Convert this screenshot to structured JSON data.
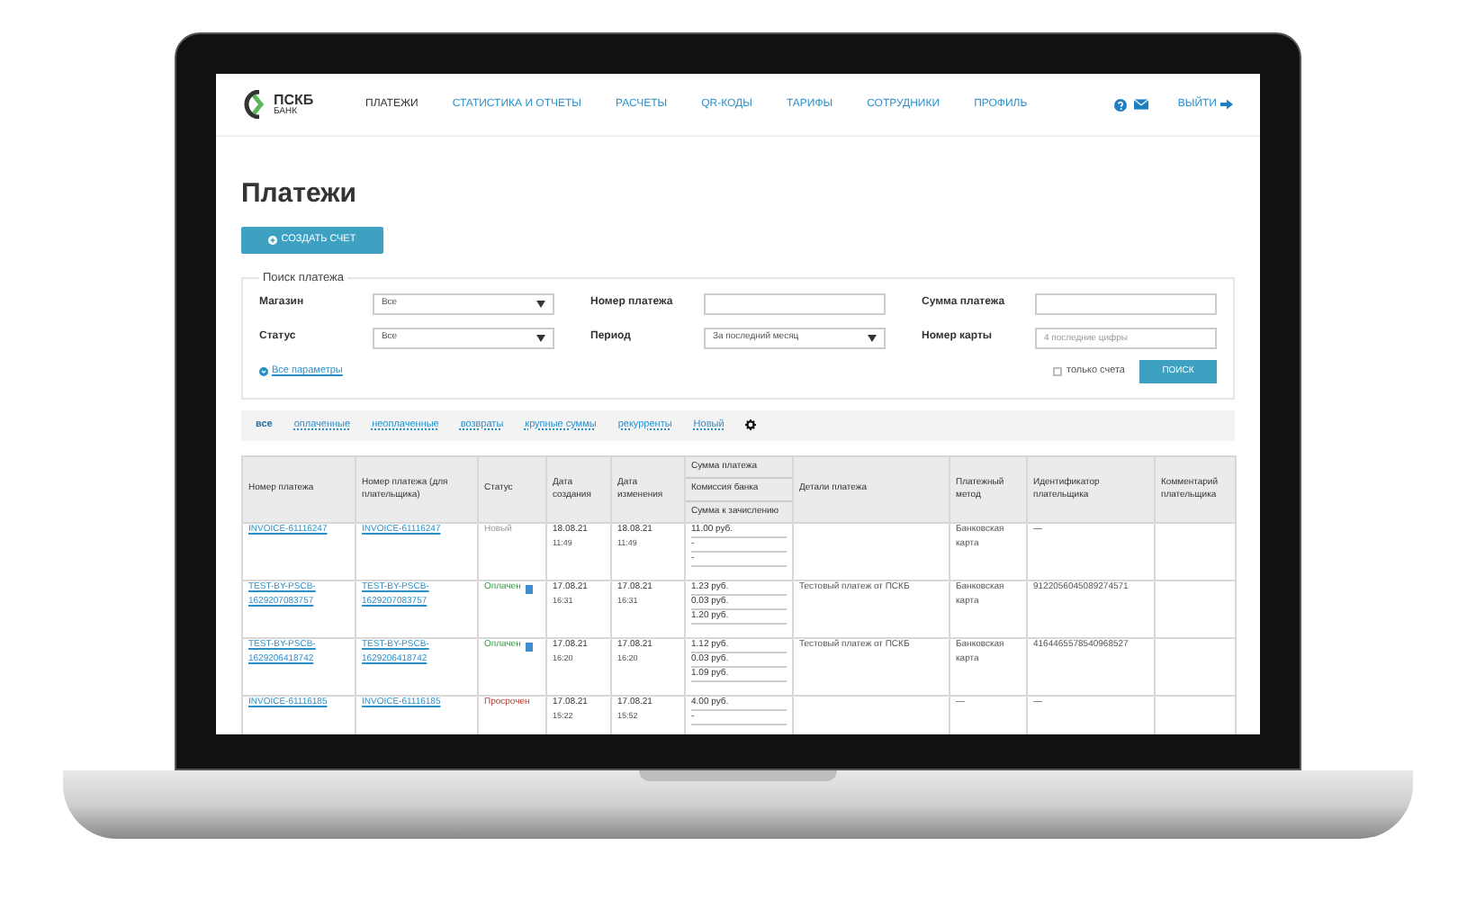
{
  "logo": {
    "name": "ПСКБ",
    "subtitle": "БАНК"
  },
  "nav": [
    {
      "label": "ПЛАТЕЖИ",
      "selected": true
    },
    {
      "label": "СТАТИСТИКА И ОТЧЕТЫ",
      "selected": false
    },
    {
      "label": "РАСЧЕТЫ",
      "selected": false
    },
    {
      "label": "QR-КОДЫ",
      "selected": false
    },
    {
      "label": "ТАРИФЫ",
      "selected": false
    },
    {
      "label": "СОТРУДНИКИ",
      "selected": false
    },
    {
      "label": "ПРОФИЛЬ",
      "selected": false
    }
  ],
  "logout": "ВЫЙТИ",
  "page_title": "Платежи",
  "create_button": "СОЗДАТЬ СЧЕТ",
  "search": {
    "legend": "Поиск платежа",
    "fields": [
      {
        "label": "Магазин",
        "kind": "select",
        "value": "Все"
      },
      {
        "label": "Номер платежа",
        "kind": "input"
      },
      {
        "label": "Сумма платежа",
        "kind": "input"
      },
      {
        "label": "Статус",
        "kind": "select",
        "value": "Все"
      },
      {
        "label": "Период",
        "kind": "select",
        "value": "За последний месяц"
      },
      {
        "label": "Номер карты",
        "kind": "input",
        "placeholder": "4 последние цифры"
      }
    ],
    "all_params": "Все параметры",
    "invoices_only": {
      "label": "только счета",
      "checked": false
    },
    "button": "ПОИСК"
  },
  "filters": [
    {
      "label": "все",
      "selected": true
    },
    {
      "label": "оплаченные",
      "selected": false
    },
    {
      "label": "неоплаченные",
      "selected": false
    },
    {
      "label": "возвраты",
      "selected": false
    },
    {
      "label": "крупные суммы",
      "selected": false
    },
    {
      "label": "рекурренты",
      "selected": false
    },
    {
      "label": "Новый",
      "selected": false
    }
  ],
  "table": {
    "columns": [
      "Номер платежа",
      "Номер платежа (для плательщика)",
      "Статус",
      "Дата создания",
      "Дата изменения",
      [
        "Сумма платежа",
        "Комиссия банка",
        "Сумма к зачислению"
      ],
      "Детали платежа",
      "Платежный метод",
      "Идентификатор плательщика",
      "Комментарий плательщика"
    ],
    "rows": [
      {
        "id": "INVOICE-61116247",
        "payer_id": "INVOICE-61116247",
        "status": {
          "text": "Новый",
          "kind": "new"
        },
        "created": [
          "18.08.21",
          "11:49"
        ],
        "changed": [
          "18.08.21",
          "11:49"
        ],
        "sums": [
          "11.00 руб.",
          "-",
          "-"
        ],
        "details": "",
        "method": "Банковская карта",
        "payer": "—"
      },
      {
        "id": "TEST-BY-PSCB-1629207083757",
        "payer_id": "TEST-BY-PSCB-1629207083757",
        "status": {
          "text": "Оплачен",
          "kind": "paid"
        },
        "created": [
          "17.08.21",
          "16:31"
        ],
        "changed": [
          "17.08.21",
          "16:31"
        ],
        "sums": [
          "1.23 руб.",
          "0.03 руб.",
          "1.20 руб."
        ],
        "details": "Тестовый платеж от ПСКБ",
        "method": "Банковская карта",
        "payer": "9122056045089274571"
      },
      {
        "id": "TEST-BY-PSCB-1629206418742",
        "payer_id": "TEST-BY-PSCB-1629206418742",
        "status": {
          "text": "Оплачен",
          "kind": "paid"
        },
        "created": [
          "17.08.21",
          "16:20"
        ],
        "changed": [
          "17.08.21",
          "16:20"
        ],
        "sums": [
          "1.12 руб.",
          "0.03 руб.",
          "1.09 руб."
        ],
        "details": "Тестовый платеж от ПСКБ",
        "method": "Банковская карта",
        "payer": "4164465578540968527"
      },
      {
        "id": "INVOICE-61116185",
        "payer_id": "INVOICE-61116185",
        "status": {
          "text": "Просрочен",
          "kind": "overdue"
        },
        "created": [
          "17.08.21",
          "15:22"
        ],
        "changed": [
          "17.08.21",
          "15:52"
        ],
        "sums": [
          "4.00 руб.",
          "-"
        ],
        "details": "",
        "method": "—",
        "payer": "—"
      }
    ]
  }
}
